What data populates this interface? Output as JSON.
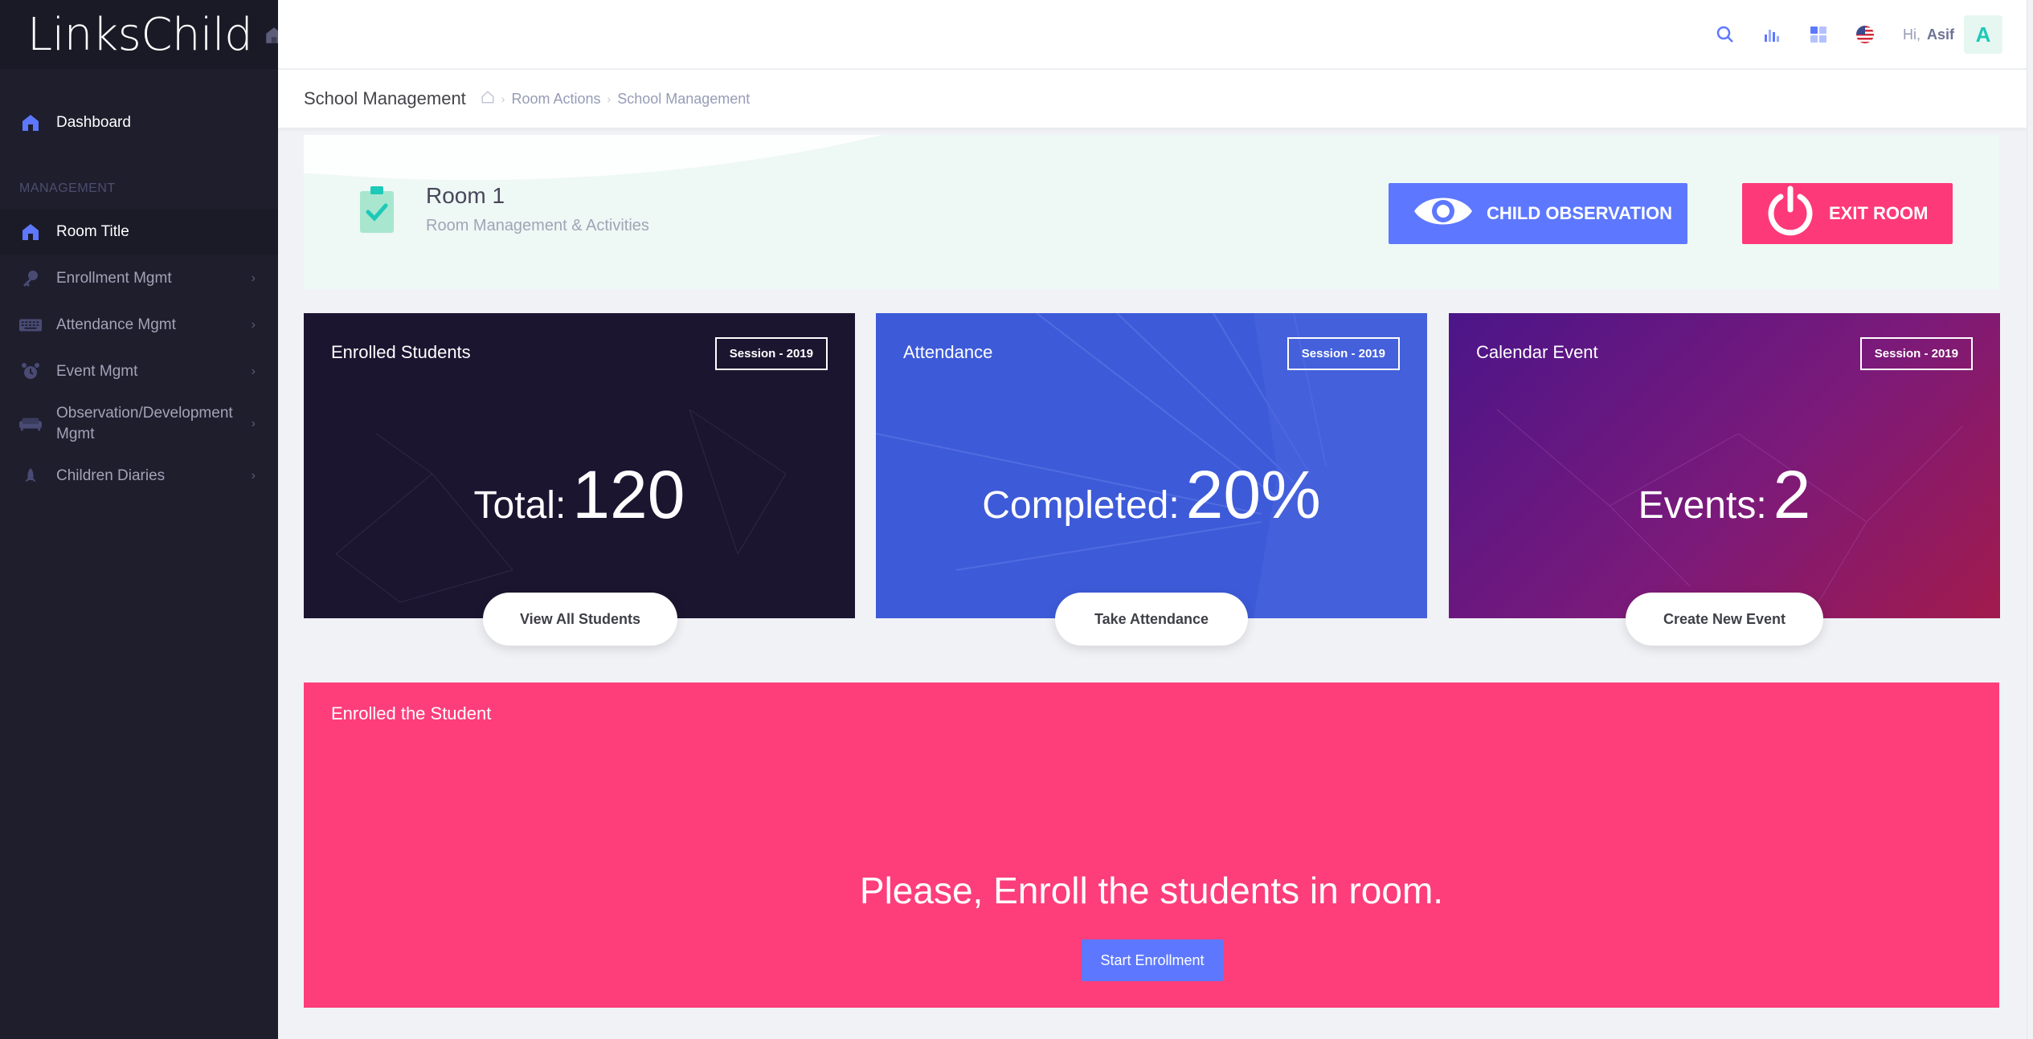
{
  "brand": {
    "name": "LinksChild"
  },
  "sidebar": {
    "dashboard": "Dashboard",
    "section_label": "MANAGEMENT",
    "items": [
      {
        "label": "Room Title",
        "icon": "home-icon"
      },
      {
        "label": "Enrollment Mgmt",
        "icon": "key-icon"
      },
      {
        "label": "Attendance Mgmt",
        "icon": "keyboard-icon"
      },
      {
        "label": "Event Mgmt",
        "icon": "alarm-icon"
      },
      {
        "label": "Observation/Development Mgmt",
        "icon": "sofa-icon"
      },
      {
        "label": "Children Diaries",
        "icon": "rocket-icon"
      }
    ]
  },
  "header": {
    "greeting": "Hi,",
    "user_name": "Asif",
    "avatar_letter": "A"
  },
  "subheader": {
    "title": "School Management",
    "breadcrumbs": [
      "Room Actions",
      "School Management"
    ]
  },
  "room": {
    "title": "Room 1",
    "subtitle": "Room Management & Activities",
    "observe_label": "CHILD OBSERVATION",
    "exit_label": "EXIT ROOM"
  },
  "cards": [
    {
      "title": "Enrolled Students",
      "badge": "Session - 2019",
      "stat_label": "Total:",
      "stat_value": "120",
      "action": "View All Students"
    },
    {
      "title": "Attendance",
      "badge": "Session - 2019",
      "stat_label": "Completed:",
      "stat_value": "20%",
      "action": "Take Attendance"
    },
    {
      "title": "Calendar Event",
      "badge": "Session - 2019",
      "stat_label": "Events:",
      "stat_value": "2",
      "action": "Create New Event"
    }
  ],
  "enroll_panel": {
    "title": "Enrolled the Student",
    "message": "Please, Enroll the students in room.",
    "button": "Start Enrollment"
  },
  "colors": {
    "sidebar_bg": "#1e1e2d",
    "accent_blue": "#5d78ff",
    "accent_pink": "#fd397a",
    "success": "#1dc9b7"
  }
}
